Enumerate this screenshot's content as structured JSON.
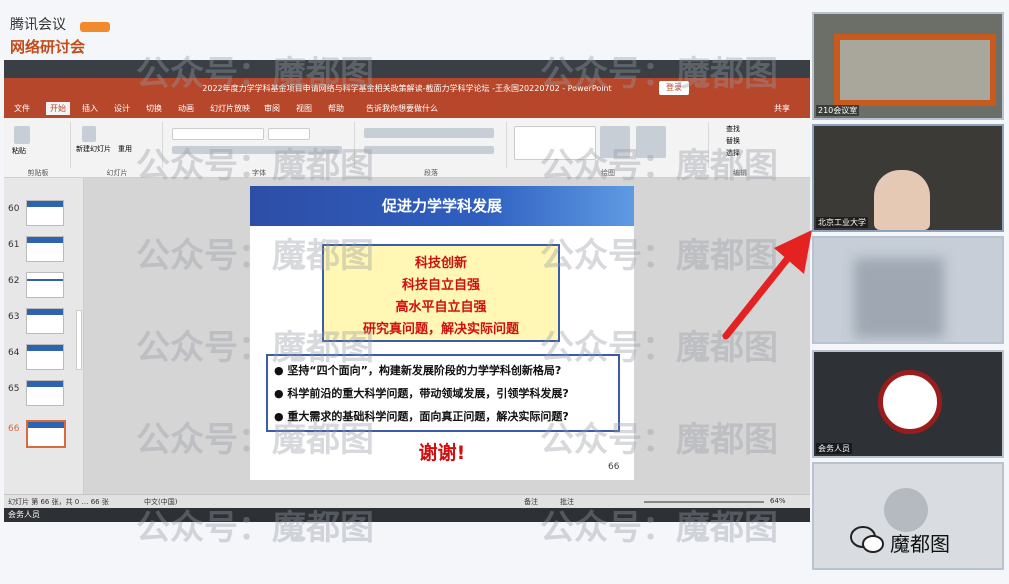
{
  "app": {
    "name_line1": "腾讯会议",
    "name_line2": "网络研讨会"
  },
  "ppt": {
    "window_title": "2022年度力学学科基金项目申请网络与科学基金相关政策解读-截面力学科学论坛 -王永国20220702 - PowerPoint",
    "signin": "登录",
    "share": "共享",
    "tabs": [
      "文件",
      "开始",
      "插入",
      "设计",
      "切换",
      "动画",
      "幻灯片放映",
      "审阅",
      "视图",
      "帮助"
    ],
    "tell_me": "告诉我你想要做什么",
    "groups": [
      "剪贴板",
      "幻灯片",
      "字体",
      "段落",
      "绘图",
      "编辑"
    ],
    "buttons": {
      "paste": "粘贴",
      "new_slide": "新建幻灯片",
      "reuse": "重用",
      "find": "查找",
      "replace": "替换",
      "select": "选择"
    }
  },
  "thumbs": [
    "60",
    "61",
    "62",
    "63",
    "64",
    "65",
    "66"
  ],
  "slide": {
    "title": "促进力学学科发展",
    "keywords": [
      "科技创新",
      "科技自立自强",
      "高水平自立自强",
      "研究真问题，解决实际问题"
    ],
    "bullets": [
      "● 坚持“四个面向”，构建新发展阶段的力学学科创新格局?",
      "● 科学前沿的重大科学问题，带动领域发展，引领学科发展?",
      "● 重大需求的基础科学问题，面向真正问题，解决实际问题?"
    ],
    "thanks": "谢谢!",
    "number": "66"
  },
  "status": {
    "slide_info": "幻灯片 第 66 张，共 0 … 66 张",
    "language": "中文(中国)",
    "notes": "备注",
    "comments": "批注",
    "zoom": "64%"
  },
  "share_label": "会务人员",
  "participants": [
    {
      "name": "210会议室"
    },
    {
      "name": "北京工业大学"
    },
    {
      "name": ""
    },
    {
      "name": "会务人员"
    },
    {
      "name": ""
    }
  ],
  "watermark": "公众号：魔都图",
  "channel": "魔都图",
  "colors": {
    "accent": "#b7472a",
    "slide_blue": "#2d4ea6",
    "keyword_red": "#d01010",
    "arrow": "#e52222"
  }
}
